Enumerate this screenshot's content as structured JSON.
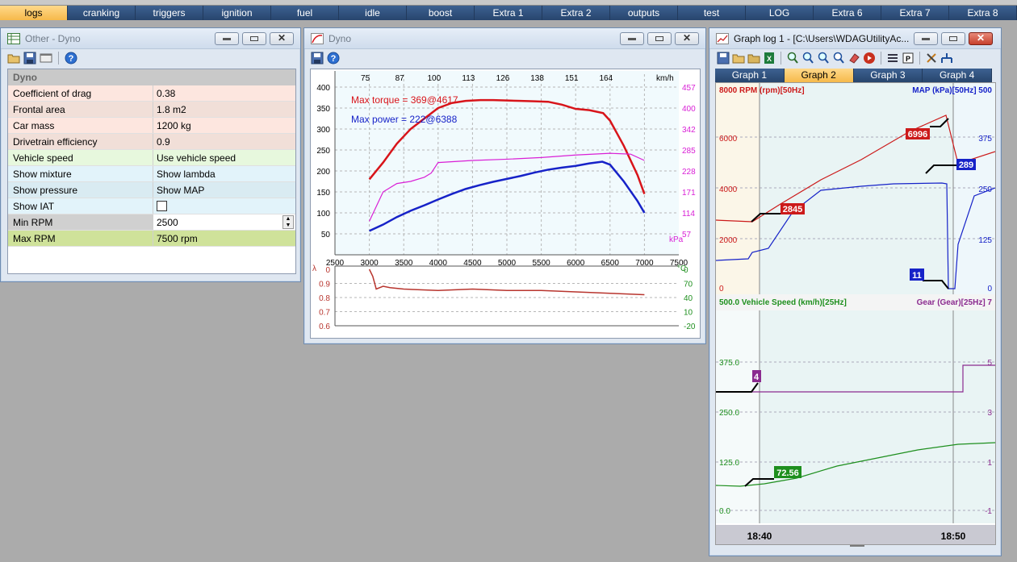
{
  "tabs": [
    "logs",
    "cranking",
    "triggers",
    "ignition",
    "fuel",
    "idle",
    "boost",
    "Extra 1",
    "Extra 2",
    "outputs",
    "test",
    "LOG",
    "Extra 6",
    "Extra 7",
    "Extra 8"
  ],
  "dyno_settings": {
    "title": "Other - Dyno",
    "group": "Dyno",
    "rows": [
      {
        "key": "Coefficient of drag",
        "value": "0.38"
      },
      {
        "key": "Frontal area",
        "value": "1.8 m2"
      },
      {
        "key": "Car mass",
        "value": "1200 kg"
      },
      {
        "key": "Drivetrain efficiency",
        "value": "0.9"
      },
      {
        "key": "Vehicle speed",
        "value": "Use vehicle speed"
      },
      {
        "key": "Show mixture",
        "value": "Show lambda"
      },
      {
        "key": "Show pressure",
        "value": "Show MAP"
      },
      {
        "key": "Show IAT",
        "value": ""
      },
      {
        "key": "Min RPM",
        "value": "2500"
      },
      {
        "key": "Max RPM",
        "value": "7500 rpm"
      }
    ],
    "row_colors": [
      "#fde6df",
      "#f1dfd8",
      "#fde6df",
      "#f1dfd8",
      "#e7f8dd",
      "#e2f3fa",
      "#d9ebf2",
      "#e2f3fa",
      "#d0d0d0",
      "#cfe29a"
    ]
  },
  "dyno_graph": {
    "title": "Dyno",
    "torque_label": "Max torque = 369@4617",
    "power_label": "Max power = 222@6388",
    "speed_ticks": [
      "75",
      "87",
      "100",
      "113",
      "126",
      "138",
      "151",
      "164"
    ],
    "speed_unit": "km/h",
    "left_ticks": [
      "400",
      "350",
      "300",
      "250",
      "200",
      "150",
      "100",
      "50"
    ],
    "right_ticks": [
      "457",
      "400",
      "342",
      "285",
      "228",
      "171",
      "114",
      "57"
    ],
    "right_unit": "kPa",
    "rpm_ticks": [
      "2500",
      "3000",
      "3500",
      "4000",
      "4500",
      "5000",
      "5500",
      "6000",
      "6500",
      "7000",
      "7500"
    ],
    "lambda_unit": "λ",
    "lambda_ticks": [
      "0",
      "0.9",
      "0.8",
      "0.7",
      "0.6"
    ],
    "temp_unit": "°C",
    "temp_ticks": [
      "0",
      "70",
      "40",
      "10",
      "-20"
    ]
  },
  "chart_data": [
    {
      "type": "line",
      "title": "",
      "xlabel": "",
      "ylabel": "",
      "xlim": [
        2500,
        7500
      ],
      "ylim": [
        0,
        400
      ],
      "series": [
        {
          "name": "Torque",
          "x": [
            3000,
            3200,
            3400,
            3600,
            3800,
            4000,
            4200,
            4400,
            4617,
            4800,
            5000,
            5200,
            5400,
            5600,
            5800,
            6000,
            6200,
            6400,
            6500,
            6700,
            6900,
            7000
          ],
          "y": [
            180,
            220,
            265,
            300,
            325,
            350,
            362,
            367,
            369,
            369,
            368,
            367,
            366,
            365,
            358,
            348,
            345,
            338,
            320,
            260,
            190,
            145
          ]
        },
        {
          "name": "Power",
          "x": [
            3000,
            3200,
            3400,
            3600,
            3800,
            4000,
            4200,
            4400,
            4600,
            4800,
            5000,
            5200,
            5400,
            5600,
            5800,
            6000,
            6200,
            6388,
            6500,
            6700,
            6900,
            7000
          ],
          "y": [
            57,
            72,
            90,
            105,
            118,
            132,
            145,
            157,
            166,
            174,
            181,
            188,
            196,
            203,
            208,
            212,
            218,
            222,
            215,
            175,
            128,
            100
          ]
        },
        {
          "name": "MAP",
          "x": [
            3000,
            3200,
            3400,
            3600,
            3800,
            3900,
            4000,
            4500,
            5000,
            5500,
            6000,
            6500,
            6800,
            7000
          ],
          "y": [
            80,
            150,
            170,
            175,
            185,
            195,
            220,
            225,
            228,
            232,
            238,
            242,
            240,
            225
          ]
        }
      ]
    },
    {
      "type": "line",
      "title": "",
      "xlim": [
        2500,
        7500
      ],
      "ylim": [
        0.6,
        1.0
      ],
      "series": [
        {
          "name": "Lambda",
          "x": [
            3000,
            3050,
            3100,
            3200,
            3300,
            3500,
            4000,
            4500,
            5000,
            5500,
            6000,
            6500,
            7000
          ],
          "y": [
            1.0,
            0.95,
            0.86,
            0.88,
            0.87,
            0.86,
            0.85,
            0.86,
            0.85,
            0.85,
            0.84,
            0.83,
            0.82
          ]
        }
      ]
    }
  ],
  "graph_log": {
    "title": "Graph log 1 - [C:\\Users\\WDAGUtilityAc...",
    "tabs": [
      "Graph 1",
      "Graph 2",
      "Graph 3",
      "Graph 4"
    ],
    "active_tab": 1,
    "top_left_label": "8000 RPM (rpm)[50Hz]",
    "top_right_label": "MAP (kPa)[50Hz] 500",
    "top_left_ticks": [
      "6000",
      "4000",
      "2000",
      "0"
    ],
    "top_right_ticks": [
      "375",
      "250",
      "125",
      "0"
    ],
    "rpm_markers": [
      "6996",
      "2845"
    ],
    "map_markers": [
      "289",
      "11"
    ],
    "bottom_left_label": "500.0 Vehicle Speed (km/h)[25Hz]",
    "bottom_right_label": "Gear (Gear)[25Hz] 7",
    "bottom_left_ticks": [
      "375.0",
      "250.0",
      "125.0",
      "0.0"
    ],
    "bottom_right_ticks": [
      "5",
      "3",
      "1",
      "-1"
    ],
    "gear_marker": "4",
    "speed_marker": "72.56",
    "time_labels": [
      "18:40",
      "18:50"
    ]
  },
  "colors": {
    "torque": "#d8141a",
    "power": "#1622c8",
    "map": "#d91fd6",
    "lambda": "#b8352e",
    "rpm": "#cc1a1a",
    "speed": "#1e8f1e",
    "gear": "#8b2a8f",
    "accent_tab": "#f6b94a"
  }
}
